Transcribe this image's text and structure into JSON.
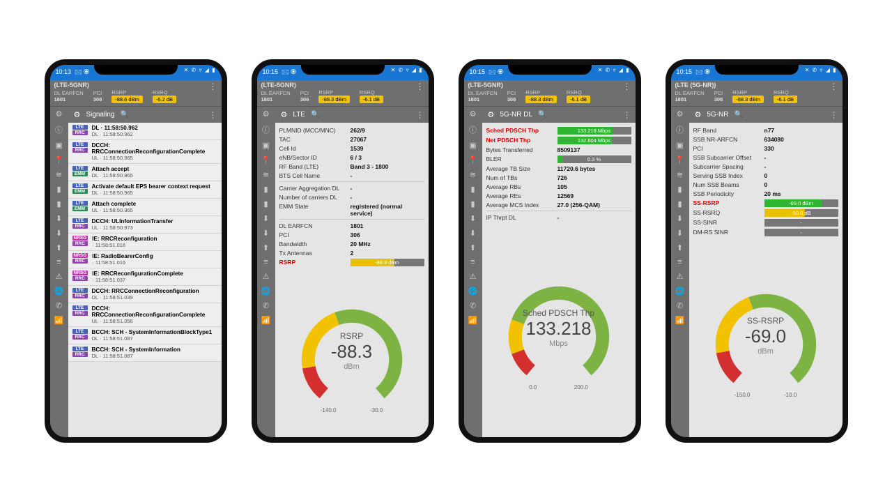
{
  "phones": [
    {
      "status_time": "10:13",
      "header": {
        "title": "(LTE-5GNR)",
        "earfcn_lbl": "DL EARFCN",
        "earfcn": "1801",
        "pci_lbl": "PCI",
        "pci": "306",
        "rsrp_lbl": "RSRP",
        "rsrp": "-88.6 dBm",
        "rsrq_lbl": "RSRQ",
        "rsrq": "-6.2 dB"
      },
      "tab": "Signaling",
      "items": [
        {
          "tags": [
            "LTE",
            "RRC"
          ],
          "txt": "DL · 11:58:50.962",
          "line": ""
        },
        {
          "tags": [
            "LTE",
            "RRC"
          ],
          "txt": "DCCH: RRCConnectionReconfigurationComplete",
          "ts": "UL · 11:58:50.965"
        },
        {
          "tags": [
            "LTE",
            "EMM"
          ],
          "txt": "Attach accept",
          "ts": "DL · 11:58:50.965"
        },
        {
          "tags": [
            "LTE",
            "EMM"
          ],
          "txt": "Activate default EPS bearer context request",
          "ts": "DL · 11:58:50.965"
        },
        {
          "tags": [
            "LTE",
            "EMM"
          ],
          "txt": "Attach complete",
          "ts": "UL · 11:58:50.965"
        },
        {
          "tags": [
            "LTE",
            "RRC"
          ],
          "txt": "DCCH: ULInformationTransfer",
          "ts": "UL · 11:58:50.973"
        },
        {
          "tags": [
            "NRSG",
            "RRC"
          ],
          "txt": "IE: RRCReconfiguration",
          "ts": "· 11:58:51.016"
        },
        {
          "tags": [
            "NRSG",
            "RRC"
          ],
          "txt": "IE: RadioBearerConfig",
          "ts": "· 11:58:51.016"
        },
        {
          "tags": [
            "NRSG",
            "RRC"
          ],
          "txt": "IE: RRCReconfigurationComplete",
          "ts": "· 11:58:51.037"
        },
        {
          "tags": [
            "LTE",
            "RRC"
          ],
          "txt": "DCCH: RRCConnectionReconfiguration",
          "ts": "DL · 11:58:51.039"
        },
        {
          "tags": [
            "LTE",
            "RRC"
          ],
          "txt": "DCCH: RRCConnectionReconfigurationComplete",
          "ts": "UL · 11:58:51.056"
        },
        {
          "tags": [
            "LTE",
            "RRC"
          ],
          "txt": "BCCH: SCH - SystemInformationBlockType1",
          "ts": "DL · 11:58:51.087"
        },
        {
          "tags": [
            "LTE",
            "RRC"
          ],
          "txt": "BCCH: SCH - SystemInformation",
          "ts": "DL · 11:58:51.087"
        }
      ]
    },
    {
      "status_time": "10:15",
      "header": {
        "title": "(LTE-5GNR)",
        "earfcn_lbl": "DL EARFCN",
        "earfcn": "1801",
        "pci_lbl": "PCI",
        "pci": "306",
        "rsrp_lbl": "RSRP",
        "rsrp": "-88.3 dBm",
        "rsrq_lbl": "RSRQ",
        "rsrq": "-6.1 dB"
      },
      "tab": "LTE",
      "kv": [
        {
          "k": "PLMNID (MCC/MNC)",
          "v": "262/9"
        },
        {
          "k": "TAC",
          "v": "27067"
        },
        {
          "k": "Cell Id",
          "v": "1539"
        },
        {
          "k": "eNB/Sector ID",
          "v": "6 / 3"
        },
        {
          "k": "RF Band (LTE)",
          "v": "Band 3 - 1800"
        },
        {
          "k": "BTS Cell Name",
          "v": "-"
        },
        {
          "sep": true
        },
        {
          "k": "Carrier Aggregation DL",
          "v": "-"
        },
        {
          "k": "Number of carriers DL",
          "v": "-"
        },
        {
          "k": "EMM State",
          "v": "registered (normal service)"
        },
        {
          "sep": true
        },
        {
          "k": "DL EARFCN",
          "v": "1801"
        },
        {
          "k": "PCI",
          "v": "306"
        },
        {
          "k": "Bandwidth",
          "v": "20 MHz"
        },
        {
          "k": "Tx Antennas",
          "v": "2"
        },
        {
          "k": "RSRP",
          "bar": {
            "color": "#e8c000",
            "text": "-88.3 dBm",
            "w": 60
          },
          "red": true
        }
      ],
      "gauge": {
        "metric": "RSRP",
        "value": "-88.3",
        "unit": "dBm",
        "ticks": [
          "-140.0",
          "-30.0"
        ]
      }
    },
    {
      "status_time": "10:15",
      "header": {
        "title": "(LTE-5GNR)",
        "earfcn_lbl": "DL EARFCN",
        "earfcn": "1801",
        "pci_lbl": "PCI",
        "pci": "306",
        "rsrp_lbl": "RSRP",
        "rsrp": "-88.3 dBm",
        "rsrq_lbl": "RSRQ",
        "rsrq": "-6.1 dB"
      },
      "tab": "5G-NR DL",
      "kv": [
        {
          "k": "Sched PDSCH Thp",
          "bar": {
            "color": "#2fb433",
            "text": "133.218 Mbps",
            "w": 75
          },
          "red": true
        },
        {
          "k": "Net PDSCH Thp",
          "bar": {
            "color": "#2fb433",
            "text": "132.604 Mbps",
            "w": 74
          },
          "red": true
        },
        {
          "k": "Bytes Transferred",
          "v": "8509137"
        },
        {
          "k": "BLER",
          "bar": {
            "color": "#2fb433",
            "text": "0.3 %",
            "w": 8
          }
        },
        {
          "k": "Average TB Size",
          "v": "11720.6 bytes"
        },
        {
          "k": "Num of TBs",
          "v": "726"
        },
        {
          "k": "Average RBs",
          "v": "105"
        },
        {
          "k": "Average REs",
          "v": "12569"
        },
        {
          "k": "Average MCS Index",
          "v": "27.0 (256-QAM)"
        },
        {
          "sep": true
        },
        {
          "k": "IP Thrpt DL",
          "v": "-"
        }
      ],
      "gauge": {
        "metric": "Sched PDSCH Thp",
        "value": "133.218",
        "unit": "Mbps",
        "ticks": [
          "0.0",
          "200.0"
        ]
      }
    },
    {
      "status_time": "10:15",
      "header": {
        "title": "(LTE (5G-NR))",
        "earfcn_lbl": "DL EARFCN",
        "earfcn": "1801",
        "pci_lbl": "PCI",
        "pci": "306",
        "rsrp_lbl": "RSRP",
        "rsrp": "-88.3 dBm",
        "rsrq_lbl": "RSRQ",
        "rsrq": "-6.1 dB"
      },
      "tab": "5G-NR",
      "kv": [
        {
          "k": "RF Band",
          "v": "n77"
        },
        {
          "k": "SSB NR-ARFCN",
          "v": "634080"
        },
        {
          "k": "PCI",
          "v": "330"
        },
        {
          "k": "SSB Subcarrier Offset",
          "v": "-"
        },
        {
          "k": "Subcarrier Spacing",
          "v": "-"
        },
        {
          "k": "Serving SSB Index",
          "v": "0"
        },
        {
          "k": "Num SSB Beams",
          "v": "0"
        },
        {
          "k": "SSB Periodicity",
          "v": "20 ms"
        },
        {
          "k": "SS-RSRP",
          "bar": {
            "color": "#2fb433",
            "text": "-69.0 dBm",
            "w": 78
          },
          "red": true
        },
        {
          "k": "SS-RSRQ",
          "bar": {
            "color": "#e8c000",
            "text": "-10.0 dB",
            "w": 55
          }
        },
        {
          "k": "SS-SINR",
          "bar": {
            "color": "#555",
            "text": "-",
            "w": 0
          }
        },
        {
          "k": "DM-RS SINR",
          "bar": {
            "color": "#555",
            "text": "-",
            "w": 0
          }
        }
      ],
      "gauge": {
        "metric": "SS-RSRP",
        "value": "-69.0",
        "unit": "dBm",
        "ticks": [
          "-150.0",
          "-10.0"
        ]
      }
    }
  ],
  "chart_data": [
    {
      "type": "gauge",
      "title": "RSRP",
      "value": -88.3,
      "unit": "dBm",
      "range": [
        -140,
        -30
      ]
    },
    {
      "type": "gauge",
      "title": "Sched PDSCH Thp",
      "value": 133.218,
      "unit": "Mbps",
      "range": [
        0,
        200
      ]
    },
    {
      "type": "gauge",
      "title": "SS-RSRP",
      "value": -69.0,
      "unit": "dBm",
      "range": [
        -150,
        -10
      ]
    }
  ],
  "sidebar_icons": [
    "gear",
    "info",
    "doc",
    "pin",
    "wifi",
    "bars",
    "bars2",
    "download",
    "download2",
    "upload",
    "list",
    "alert",
    "globe",
    "phone",
    "wifi2"
  ]
}
